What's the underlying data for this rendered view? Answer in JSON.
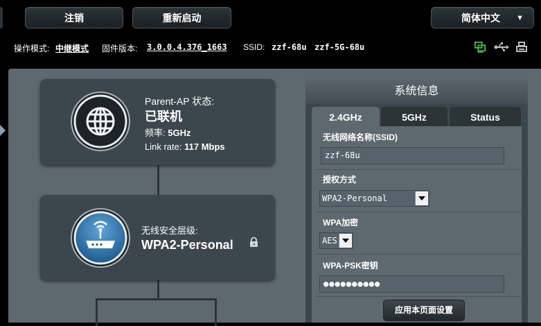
{
  "header": {
    "logout_label": "注销",
    "reboot_label": "重新启动",
    "language_label": "简体中文"
  },
  "status_line": {
    "mode_label": "操作模式:",
    "mode_value": "中继模式",
    "firmware_label": "固件版本:",
    "firmware_value": "3.0.0.4.376_1663",
    "ssid_label": "SSID:",
    "ssid_values": [
      "zzf-68u",
      "zzf-5G-68u"
    ]
  },
  "parent_ap": {
    "title": "Parent-AP 状态:",
    "state": "已联机",
    "freq_label": "频率:",
    "freq_value": "5GHz",
    "link_label": "Link rate:",
    "link_value": "117 Mbps"
  },
  "security": {
    "title": "无线安全层级:",
    "value": "WPA2-Personal"
  },
  "system_info": {
    "title": "系统信息",
    "tabs": [
      "2.4GHz",
      "5GHz",
      "Status"
    ],
    "active_tab": "2.4GHz",
    "ssid_label": "无线网络名称(SSID)",
    "ssid_value": "zzf-68u",
    "auth_label": "授权方式",
    "auth_value": "WPA2-Personal",
    "enc_label": "WPA加密",
    "enc_value": "AES",
    "psk_label": "WPA-PSK密钥",
    "psk_value": "●●●●●●●●●●",
    "apply_label": "应用本页面设置"
  },
  "colors": {
    "panel": "#5d686f",
    "card": "#3c474d",
    "status_icon_green": "#3fbf3f"
  }
}
